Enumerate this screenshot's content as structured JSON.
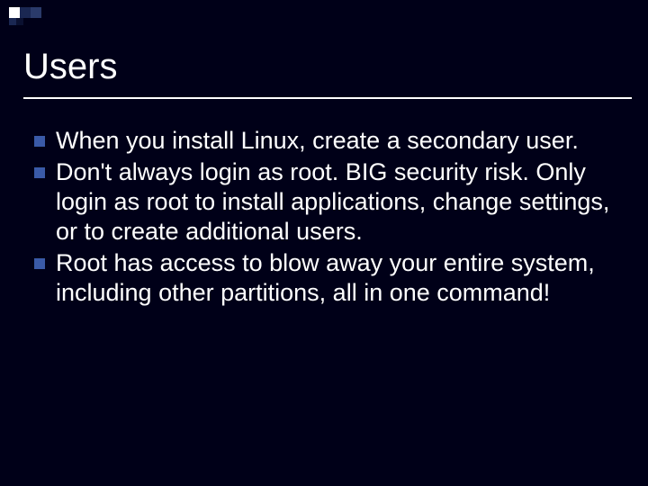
{
  "slide": {
    "title": "Users",
    "bullets": [
      "When you install Linux, create a secondary user.",
      "Don't always login as root.  BIG security risk.  Only login as root to install applications, change settings, or to create additional users.",
      "Root has access to blow away your entire system, including other partitions, all in one command!"
    ]
  }
}
